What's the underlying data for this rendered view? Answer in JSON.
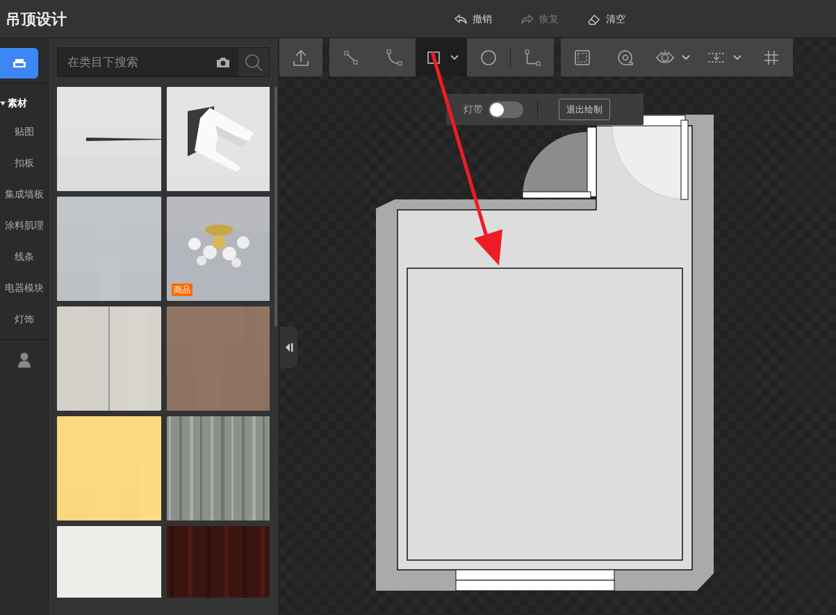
{
  "header": {
    "title": "吊顶设计",
    "actions": [
      {
        "kind": "undo",
        "label": "撤销",
        "disabled": false
      },
      {
        "kind": "redo",
        "label": "恢复",
        "disabled": true
      },
      {
        "kind": "clear",
        "label": "清空",
        "disabled": false
      }
    ]
  },
  "rail": {
    "top_button": {
      "selected": true
    },
    "categories": [
      {
        "label": "素材",
        "expanded": true,
        "children": [
          {
            "label": "贴图"
          },
          {
            "label": "扣板"
          },
          {
            "label": "集成墙板"
          },
          {
            "label": "涂料肌理"
          },
          {
            "label": "线条"
          },
          {
            "label": "电器模块"
          },
          {
            "label": "灯饰"
          }
        ]
      }
    ]
  },
  "search": {
    "placeholder": "在类目下搜索"
  },
  "tiles": [
    {
      "kind": "picture"
    },
    {
      "kind": "picture"
    },
    {
      "kind": "picture"
    },
    {
      "kind": "picture",
      "badge": "商品"
    },
    {
      "kind": "picture"
    },
    {
      "kind": "picture"
    },
    {
      "kind": "picture"
    },
    {
      "kind": "picture"
    },
    {
      "kind": "picture"
    },
    {
      "kind": "picture"
    }
  ],
  "toolbar": {
    "groups": [
      [
        {
          "kind": "upload",
          "selected": false
        }
      ],
      [
        {
          "kind": "line",
          "selected": false
        },
        {
          "kind": "curve",
          "selected": false
        },
        {
          "kind": "rectangle",
          "selected": true,
          "dropdown": true
        },
        {
          "kind": "circle",
          "selected": false
        },
        {
          "kind": "separator"
        },
        {
          "kind": "corner",
          "selected": false
        }
      ],
      [
        {
          "kind": "frame",
          "selected": false
        },
        {
          "kind": "tape",
          "selected": false
        },
        {
          "kind": "eye",
          "selected": false,
          "dropdown": true
        },
        {
          "kind": "level",
          "selected": false,
          "dropdown": true
        },
        {
          "kind": "grid",
          "selected": false
        }
      ]
    ]
  },
  "popup": {
    "toggle_label": "灯带",
    "toggle_on": false,
    "exit_button": "退出绘制"
  }
}
